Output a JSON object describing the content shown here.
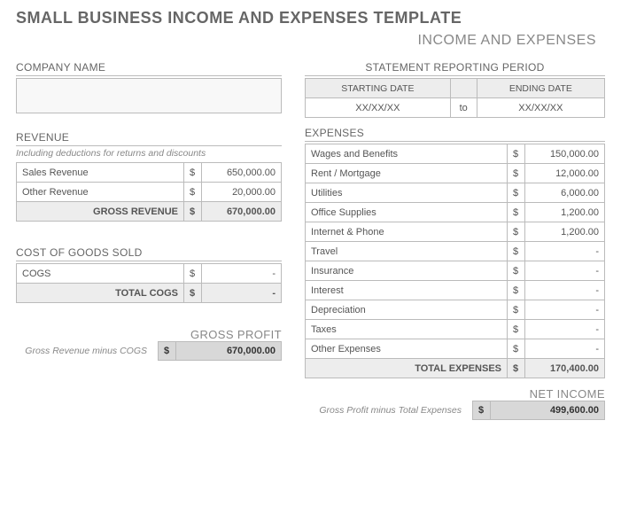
{
  "title": "SMALL BUSINESS INCOME AND EXPENSES TEMPLATE",
  "subtitle": "INCOME AND EXPENSES",
  "company": {
    "header": "COMPANY NAME",
    "value": ""
  },
  "period": {
    "header": "STATEMENT REPORTING PERIOD",
    "start_label": "STARTING DATE",
    "end_label": "ENDING DATE",
    "start_value": "XX/XX/XX",
    "to": "to",
    "end_value": "XX/XX/XX"
  },
  "revenue": {
    "header": "REVENUE",
    "note": "Including deductions for returns and discounts",
    "rows": [
      {
        "label": "Sales Revenue",
        "currency": "$",
        "value": "650,000.00"
      },
      {
        "label": "Other Revenue",
        "currency": "$",
        "value": "20,000.00"
      }
    ],
    "total_label": "GROSS REVENUE",
    "total_currency": "$",
    "total_value": "670,000.00"
  },
  "cogs": {
    "header": "COST OF GOODS SOLD",
    "rows": [
      {
        "label": "COGS",
        "currency": "$",
        "value": "-"
      }
    ],
    "total_label": "TOTAL COGS",
    "total_currency": "$",
    "total_value": "-"
  },
  "gross_profit": {
    "header": "GROSS PROFIT",
    "note": "Gross Revenue minus COGS",
    "currency": "$",
    "value": "670,000.00"
  },
  "expenses": {
    "header": "EXPENSES",
    "rows": [
      {
        "label": "Wages and Benefits",
        "currency": "$",
        "value": "150,000.00"
      },
      {
        "label": "Rent / Mortgage",
        "currency": "$",
        "value": "12,000.00"
      },
      {
        "label": "Utilities",
        "currency": "$",
        "value": "6,000.00"
      },
      {
        "label": "Office Supplies",
        "currency": "$",
        "value": "1,200.00"
      },
      {
        "label": "Internet & Phone",
        "currency": "$",
        "value": "1,200.00"
      },
      {
        "label": "Travel",
        "currency": "$",
        "value": "-"
      },
      {
        "label": "Insurance",
        "currency": "$",
        "value": "-"
      },
      {
        "label": "Interest",
        "currency": "$",
        "value": "-"
      },
      {
        "label": "Depreciation",
        "currency": "$",
        "value": "-"
      },
      {
        "label": "Taxes",
        "currency": "$",
        "value": "-"
      },
      {
        "label": "Other Expenses",
        "currency": "$",
        "value": "-"
      }
    ],
    "total_label": "TOTAL EXPENSES",
    "total_currency": "$",
    "total_value": "170,400.00"
  },
  "net_income": {
    "header": "NET INCOME",
    "note": "Gross Profit minus Total Expenses",
    "currency": "$",
    "value": "499,600.00"
  }
}
